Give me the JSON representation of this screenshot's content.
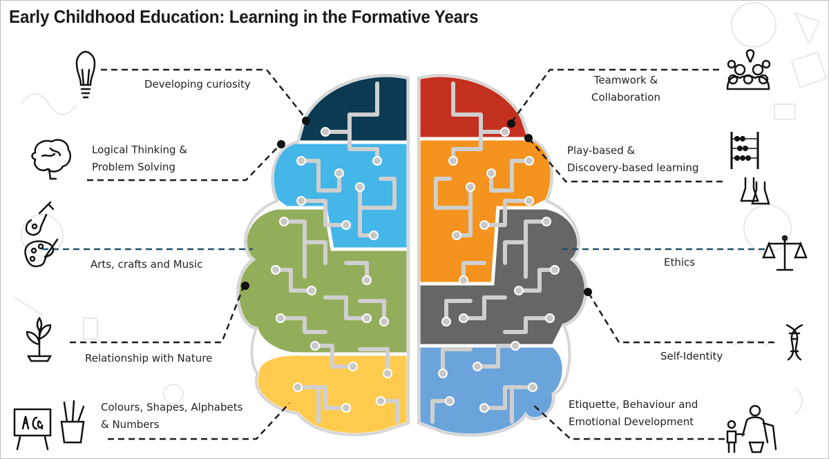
{
  "title": "Early Childhood Education: Learning in the Formative Years",
  "left_labels": [
    {
      "id": "curiosity",
      "text": "Developing curiosity",
      "icon": "lightbulb-icon"
    },
    {
      "id": "logical",
      "text": "Logical Thinking &\nProblem Solving",
      "icon": "brain-icon"
    },
    {
      "id": "arts",
      "text": "Arts, crafts and Music",
      "icon": "guitar-palette-icon"
    },
    {
      "id": "nature",
      "text": "Relationship with Nature",
      "icon": "plant-sprout-icon"
    },
    {
      "id": "colours",
      "text": "Colours, Shapes, Alphabets\n& Numbers",
      "icon": "chalkboard-pencil-cup-icon"
    }
  ],
  "right_labels": [
    {
      "id": "teamwork",
      "text": "Teamwork &\nCollaboration",
      "icon": "team-people-icon"
    },
    {
      "id": "play",
      "text": "Play-based &\nDiscovery-based learning",
      "icon": "abacus-flasks-icon"
    },
    {
      "id": "ethics",
      "text": "Ethics",
      "icon": "scales-icon"
    },
    {
      "id": "identity",
      "text": "Self-Identity",
      "icon": "dna-icon"
    },
    {
      "id": "etiquette",
      "text": "Etiquette, Behaviour and\nEmotional Development",
      "icon": "adult-child-icon"
    }
  ],
  "colors": {
    "navy": "#0d3a53",
    "sky": "#45b6e8",
    "olive": "#93ae5b",
    "yellow": "#fecb4f",
    "red": "#c4301f",
    "orange": "#f4931d",
    "gray": "#666666",
    "blue": "#6ba4da",
    "trace": "#cfcfcf",
    "dash": "#1c1c1c",
    "ethics_line": "#1f4f66"
  }
}
